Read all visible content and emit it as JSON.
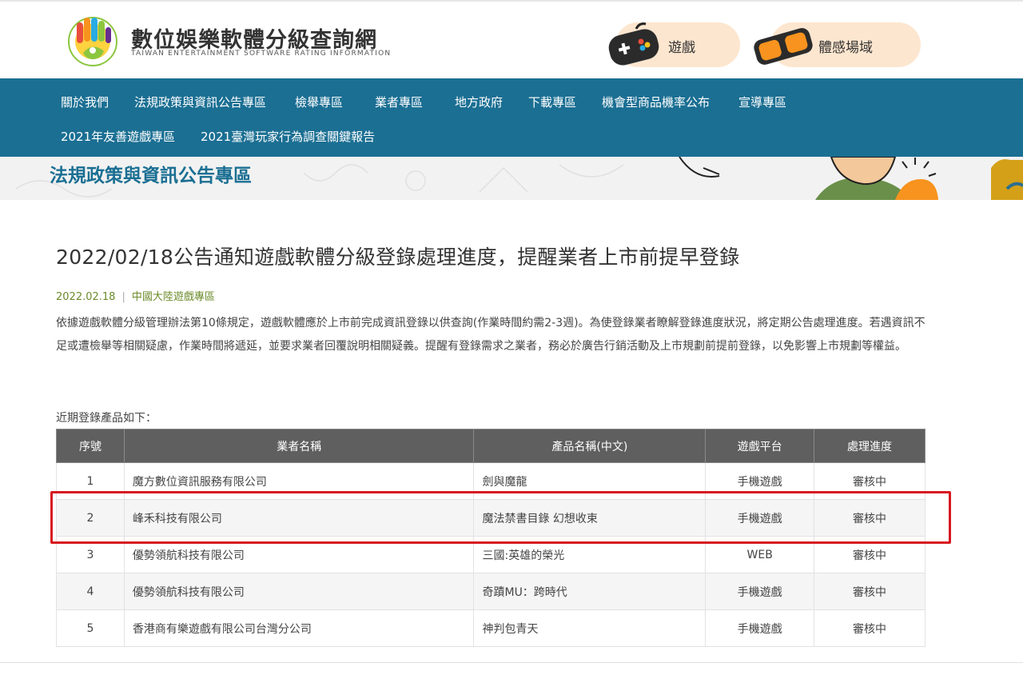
{
  "header": {
    "site_title": "數位娛樂軟體分級查詢網",
    "site_subtitle": "TAIWAN ENTERTAINMENT SOFTWARE RATING INFORMATION",
    "buttons": [
      {
        "label": "遊戲",
        "icon": "gamepad-icon"
      },
      {
        "label": "體感場域",
        "icon": "vr-goggles-icon"
      }
    ]
  },
  "nav": {
    "items": [
      "關於我們",
      "法規政策與資訊公告專區",
      "檢舉專區",
      "業者專區",
      "地方政府",
      "下載專區",
      "機會型商品機率公布",
      "宣導專區",
      "2021年友善遊戲專區",
      "2021臺灣玩家行為調查關鍵報告"
    ]
  },
  "banner": {
    "title": "法規政策與資訊公告專區"
  },
  "article": {
    "title": "2022/02/18公告通知遊戲軟體分級登錄處理進度，提醒業者上市前提早登錄",
    "date": "2022.02.18",
    "separator": "|",
    "category": "中國大陸遊戲專區",
    "body": "依據遊戲軟體分級管理辦法第10條規定，遊戲軟體應於上市前完成資訊登錄以供查詢(作業時間約需2-3週)。為使登錄業者瞭解登錄進度狀況，將定期公告處理進度。若遇資訊不足或遭檢舉等相關疑慮，作業時間將遞延，並要求業者回覆說明相關疑義。提醒有登錄需求之業者，務必於廣告行銷活動及上市規劃前提前登錄，以免影響上市規劃等權益。",
    "list_intro": "近期登錄產品如下："
  },
  "table": {
    "headers": [
      "序號",
      "業者名稱",
      "產品名稱(中文)",
      "遊戲平台",
      "處理進度"
    ],
    "rows": [
      [
        "1",
        "魔方數位資訊服務有限公司",
        "劍與魔龍",
        "手機遊戲",
        "審核中"
      ],
      [
        "2",
        "峰禾科技有限公司",
        "魔法禁書目錄 幻想收束",
        "手機遊戲",
        "審核中"
      ],
      [
        "3",
        "優勢領航科技有限公司",
        "三國:英雄的榮光",
        "WEB",
        "審核中"
      ],
      [
        "4",
        "優勢領航科技有限公司",
        "奇蹟MU：跨時代",
        "手機遊戲",
        "審核中"
      ],
      [
        "5",
        "香港商有樂遊戲有限公司台灣分公司",
        "神判包青天",
        "手機遊戲",
        "審核中"
      ]
    ]
  },
  "colors": {
    "nav_bg": "#1b6f93",
    "banner_title": "#1b6f93",
    "table_header_bg": "#5f5f5f",
    "highlight_border": "#d71920",
    "meta_text": "#6b8b2a",
    "pill_bg": "#fde6cf"
  }
}
